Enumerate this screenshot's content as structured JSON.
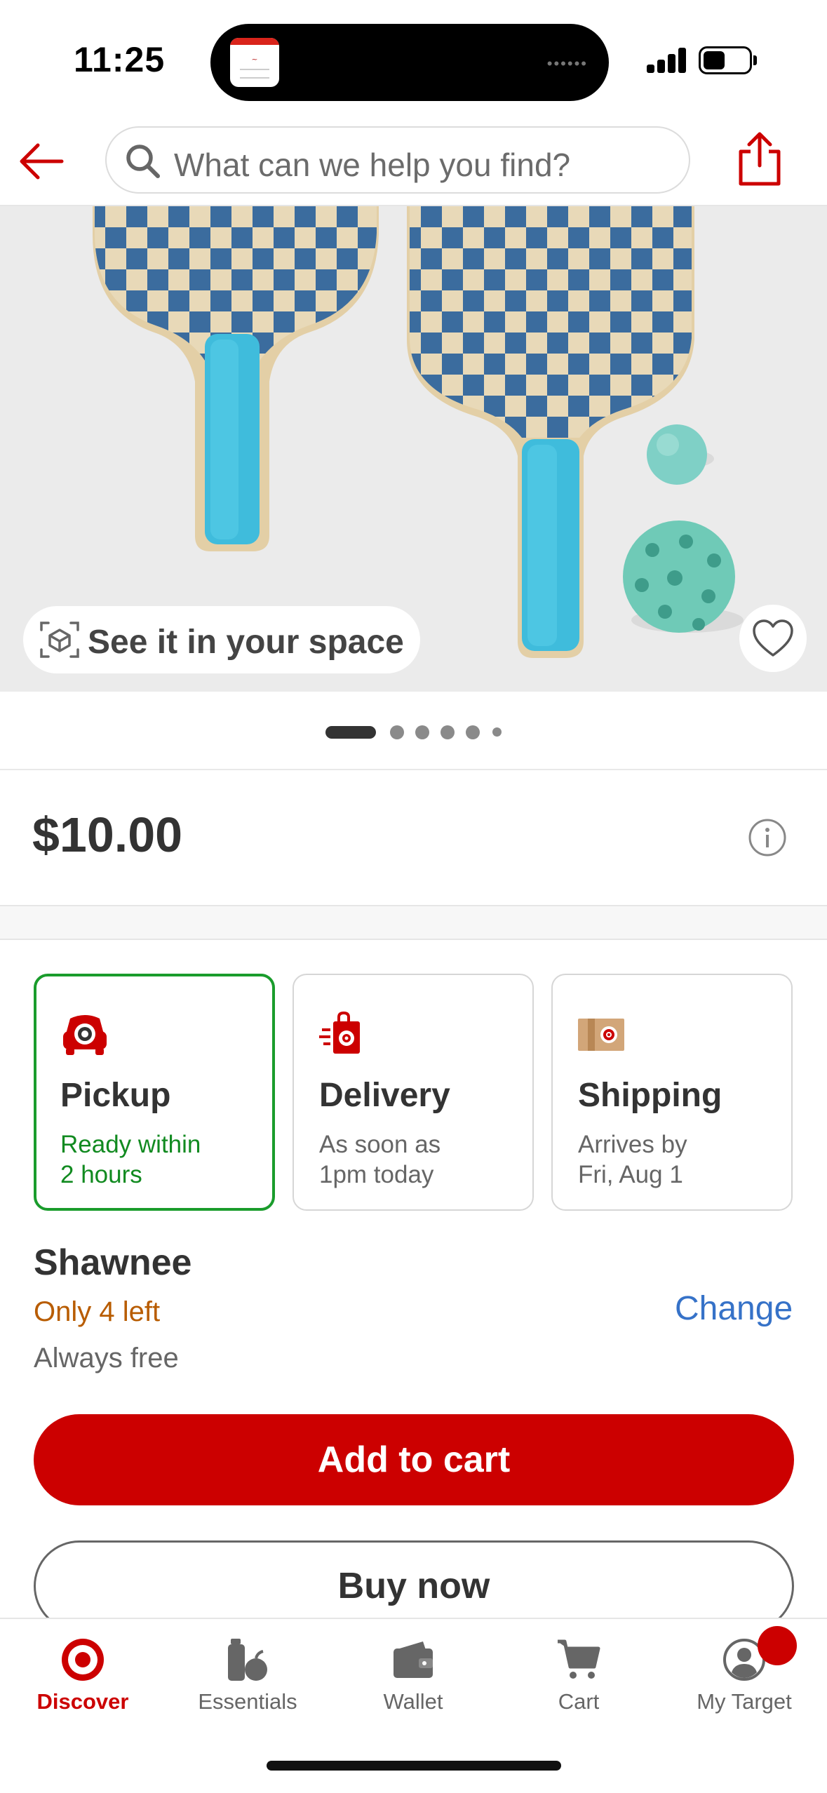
{
  "status_bar": {
    "time": "11:25"
  },
  "header": {
    "search_placeholder": "What can we help you find?"
  },
  "hero": {
    "see_in_space_label": "See it in your space",
    "image_count": 6,
    "active_image": 1
  },
  "product": {
    "price": "$10.00"
  },
  "fulfillment": {
    "options": [
      {
        "title": "Pickup",
        "line1": "Ready within",
        "line2": "2 hours",
        "selected": true
      },
      {
        "title": "Delivery",
        "line1": "As soon as",
        "line2": "1pm today",
        "selected": false
      },
      {
        "title": "Shipping",
        "line1": "Arrives by",
        "line2": "Fri, Aug 1",
        "selected": false
      }
    ]
  },
  "store": {
    "name": "Shawnee",
    "stock": "Only 4 left",
    "note": "Always free",
    "change_label": "Change"
  },
  "actions": {
    "add_to_cart": "Add to cart",
    "buy_now": "Buy now"
  },
  "tabbar": {
    "items": [
      {
        "label": "Discover",
        "icon": "target-bullseye-icon",
        "active": true
      },
      {
        "label": "Essentials",
        "icon": "essentials-icon",
        "active": false
      },
      {
        "label": "Wallet",
        "icon": "wallet-icon",
        "active": false
      },
      {
        "label": "Cart",
        "icon": "cart-icon",
        "active": false
      },
      {
        "label": "My Target",
        "icon": "account-icon",
        "active": false
      }
    ]
  },
  "colors": {
    "brand_red": "#cc0000",
    "selected_green": "#1a9c2c",
    "stock_orange": "#b85c00",
    "link_blue": "#3672c8"
  }
}
